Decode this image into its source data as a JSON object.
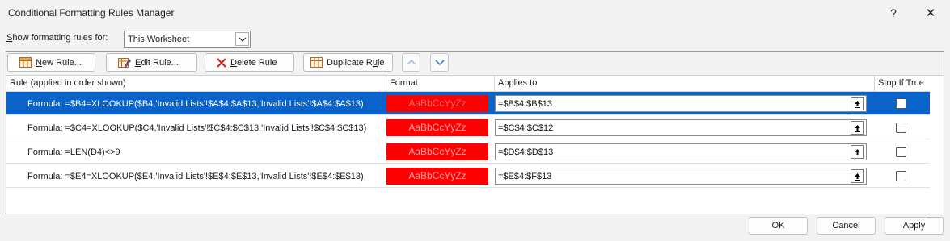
{
  "window": {
    "title": "Conditional Formatting Rules Manager",
    "help_glyph": "?",
    "close_glyph": "✕"
  },
  "show_for": {
    "label_key": "S",
    "label_rest": "how formatting rules for:",
    "selected": "This Worksheet"
  },
  "toolbar": {
    "new_key": "N",
    "new_rest": "ew Rule...",
    "edit_key": "E",
    "edit_rest": "dit Rule...",
    "delete_key": "D",
    "delete_rest": "elete Rule",
    "dup_pre": "Duplicate R",
    "dup_key": "u",
    "dup_post": "le"
  },
  "columns": {
    "rule": "Rule (applied in order shown)",
    "format": "Format",
    "applies": "Applies to",
    "stop": "Stop If True"
  },
  "rules": [
    {
      "text": "Formula: =$B4=XLOOKUP($B4,'Invalid Lists'!$A$4:$A$13,'Invalid Lists'!$A$4:$A$13)",
      "preview": "AaBbCcYyZz",
      "applies_to": "=$B$4:$B$13",
      "stop_if_true": false,
      "selected": true
    },
    {
      "text": "Formula: =$C4=XLOOKUP($C4,'Invalid Lists'!$C$4:$C$13,'Invalid Lists'!$C$4:$C$13)",
      "preview": "AaBbCcYyZz",
      "applies_to": "=$C$4:$C$12",
      "stop_if_true": false,
      "selected": false
    },
    {
      "text": "Formula: =LEN(D4)<>9",
      "preview": "AaBbCcYyZz",
      "applies_to": "=$D$4:$D$13",
      "stop_if_true": false,
      "selected": false
    },
    {
      "text": "Formula: =$E4=XLOOKUP($E4,'Invalid Lists'!$E$4:$E$13,'Invalid Lists'!$E$4:$E$13)",
      "preview": "AaBbCcYyZz",
      "applies_to": "=$E$4:$F$13",
      "stop_if_true": false,
      "selected": false
    }
  ],
  "buttons": {
    "ok": "OK",
    "cancel": "Cancel",
    "apply": "Apply"
  },
  "colors": {
    "selection": "#0a63c9",
    "format_fill": "#ff0000",
    "format_text": "#ffa3a3"
  }
}
